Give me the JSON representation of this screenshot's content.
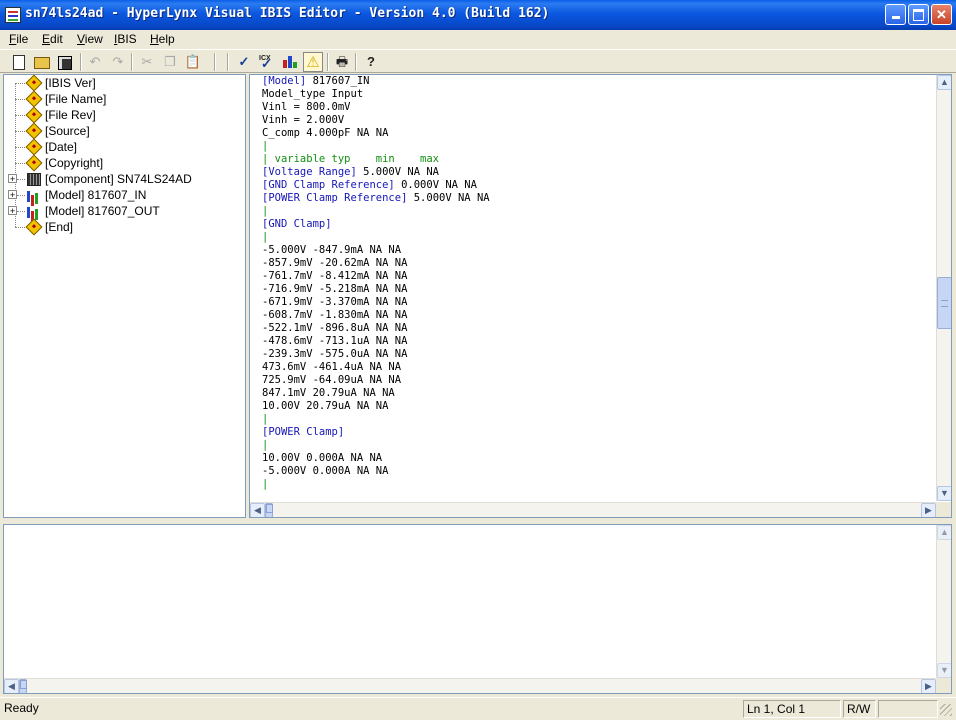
{
  "window": {
    "title": "sn74ls24ad - HyperLynx Visual IBIS Editor - Version 4.0 (Build 162)"
  },
  "menu": [
    {
      "label": "File",
      "u": "F",
      "rest": "ile"
    },
    {
      "label": "Edit",
      "u": "E",
      "rest": "dit"
    },
    {
      "label": "View",
      "u": "V",
      "rest": "iew"
    },
    {
      "label": "IBIS",
      "u": "I",
      "rest": "BIS"
    },
    {
      "label": "Help",
      "u": "H",
      "rest": "elp"
    }
  ],
  "toolbar": {
    "icons": [
      "new-file-icon",
      "open-folder-icon",
      "save-icon",
      "undo-icon",
      "redo-icon",
      "cut-icon",
      "copy-icon",
      "paste-icon",
      "check-icon",
      "ibis-check-icon",
      "chart-icon",
      "warning-icon",
      "print-icon",
      "help-icon"
    ],
    "icx_label": "ICX"
  },
  "tree": {
    "items": [
      {
        "label": "[IBIS Ver]",
        "icon": "keyword-icon",
        "expandable": false
      },
      {
        "label": "[File Name]",
        "icon": "keyword-icon",
        "expandable": false
      },
      {
        "label": "[File Rev]",
        "icon": "keyword-icon",
        "expandable": false
      },
      {
        "label": "[Source]",
        "icon": "keyword-icon",
        "expandable": false
      },
      {
        "label": "[Date]",
        "icon": "keyword-icon",
        "expandable": false
      },
      {
        "label": "[Copyright]",
        "icon": "keyword-icon",
        "expandable": false
      },
      {
        "label": "[Component] SN74LS24AD",
        "icon": "component-icon",
        "expandable": true
      },
      {
        "label": "[Model] 817607_IN",
        "icon": "model-icon",
        "expandable": true
      },
      {
        "label": "[Model] 817607_OUT",
        "icon": "model-icon",
        "expandable": true
      },
      {
        "label": "[End]",
        "icon": "keyword-icon",
        "expandable": false
      }
    ],
    "expander_symbol": "+"
  },
  "editor": {
    "lines": [
      {
        "t": "[Model] 817607_IN",
        "c": "kwline"
      },
      {
        "t": "Model_type Input",
        "c": ""
      },
      {
        "t": "Vinl = 800.0mV",
        "c": ""
      },
      {
        "t": "Vinh = 2.000V",
        "c": ""
      },
      {
        "t": "C_comp 4.000pF NA NA",
        "c": ""
      },
      {
        "t": "|",
        "c": "cm"
      },
      {
        "t": "| variable typ    min    max",
        "c": "cm"
      },
      {
        "t": "[Voltage Range] 5.000V NA NA",
        "c": "kwline"
      },
      {
        "t": "[GND Clamp Reference] 0.000V NA NA",
        "c": "kwline"
      },
      {
        "t": "[POWER Clamp Reference] 5.000V NA NA",
        "c": "kwline"
      },
      {
        "t": "|",
        "c": "cm"
      },
      {
        "t": "[GND Clamp]",
        "c": "kw"
      },
      {
        "t": "|",
        "c": "cm"
      },
      {
        "t": "-5.000V -847.9mA NA NA",
        "c": ""
      },
      {
        "t": "-857.9mV -20.62mA NA NA",
        "c": ""
      },
      {
        "t": "-761.7mV -8.412mA NA NA",
        "c": ""
      },
      {
        "t": "-716.9mV -5.218mA NA NA",
        "c": ""
      },
      {
        "t": "-671.9mV -3.370mA NA NA",
        "c": ""
      },
      {
        "t": "-608.7mV -1.830mA NA NA",
        "c": ""
      },
      {
        "t": "-522.1mV -896.8uA NA NA",
        "c": ""
      },
      {
        "t": "-478.6mV -713.1uA NA NA",
        "c": ""
      },
      {
        "t": "-239.3mV -575.0uA NA NA",
        "c": ""
      },
      {
        "t": "473.6mV -461.4uA NA NA",
        "c": ""
      },
      {
        "t": "725.9mV -64.09uA NA NA",
        "c": ""
      },
      {
        "t": "847.1mV 20.79uA NA NA",
        "c": ""
      },
      {
        "t": "10.00V 20.79uA NA NA",
        "c": ""
      },
      {
        "t": "|",
        "c": "cm"
      },
      {
        "t": "[POWER Clamp]",
        "c": "kw"
      },
      {
        "t": "|",
        "c": "cm"
      },
      {
        "t": "10.00V 0.000A NA NA",
        "c": ""
      },
      {
        "t": "-5.000V 0.000A NA NA",
        "c": ""
      },
      {
        "t": "|",
        "c": "cm"
      }
    ]
  },
  "scroll": {
    "up": "▲",
    "down": "▼",
    "left": "◀",
    "right": "▶"
  },
  "status": {
    "ready": "Ready",
    "position": "Ln 1, Col 1",
    "mode": "R/W"
  },
  "colors": {
    "keyword": "#1616b8",
    "comment": "#109010"
  }
}
